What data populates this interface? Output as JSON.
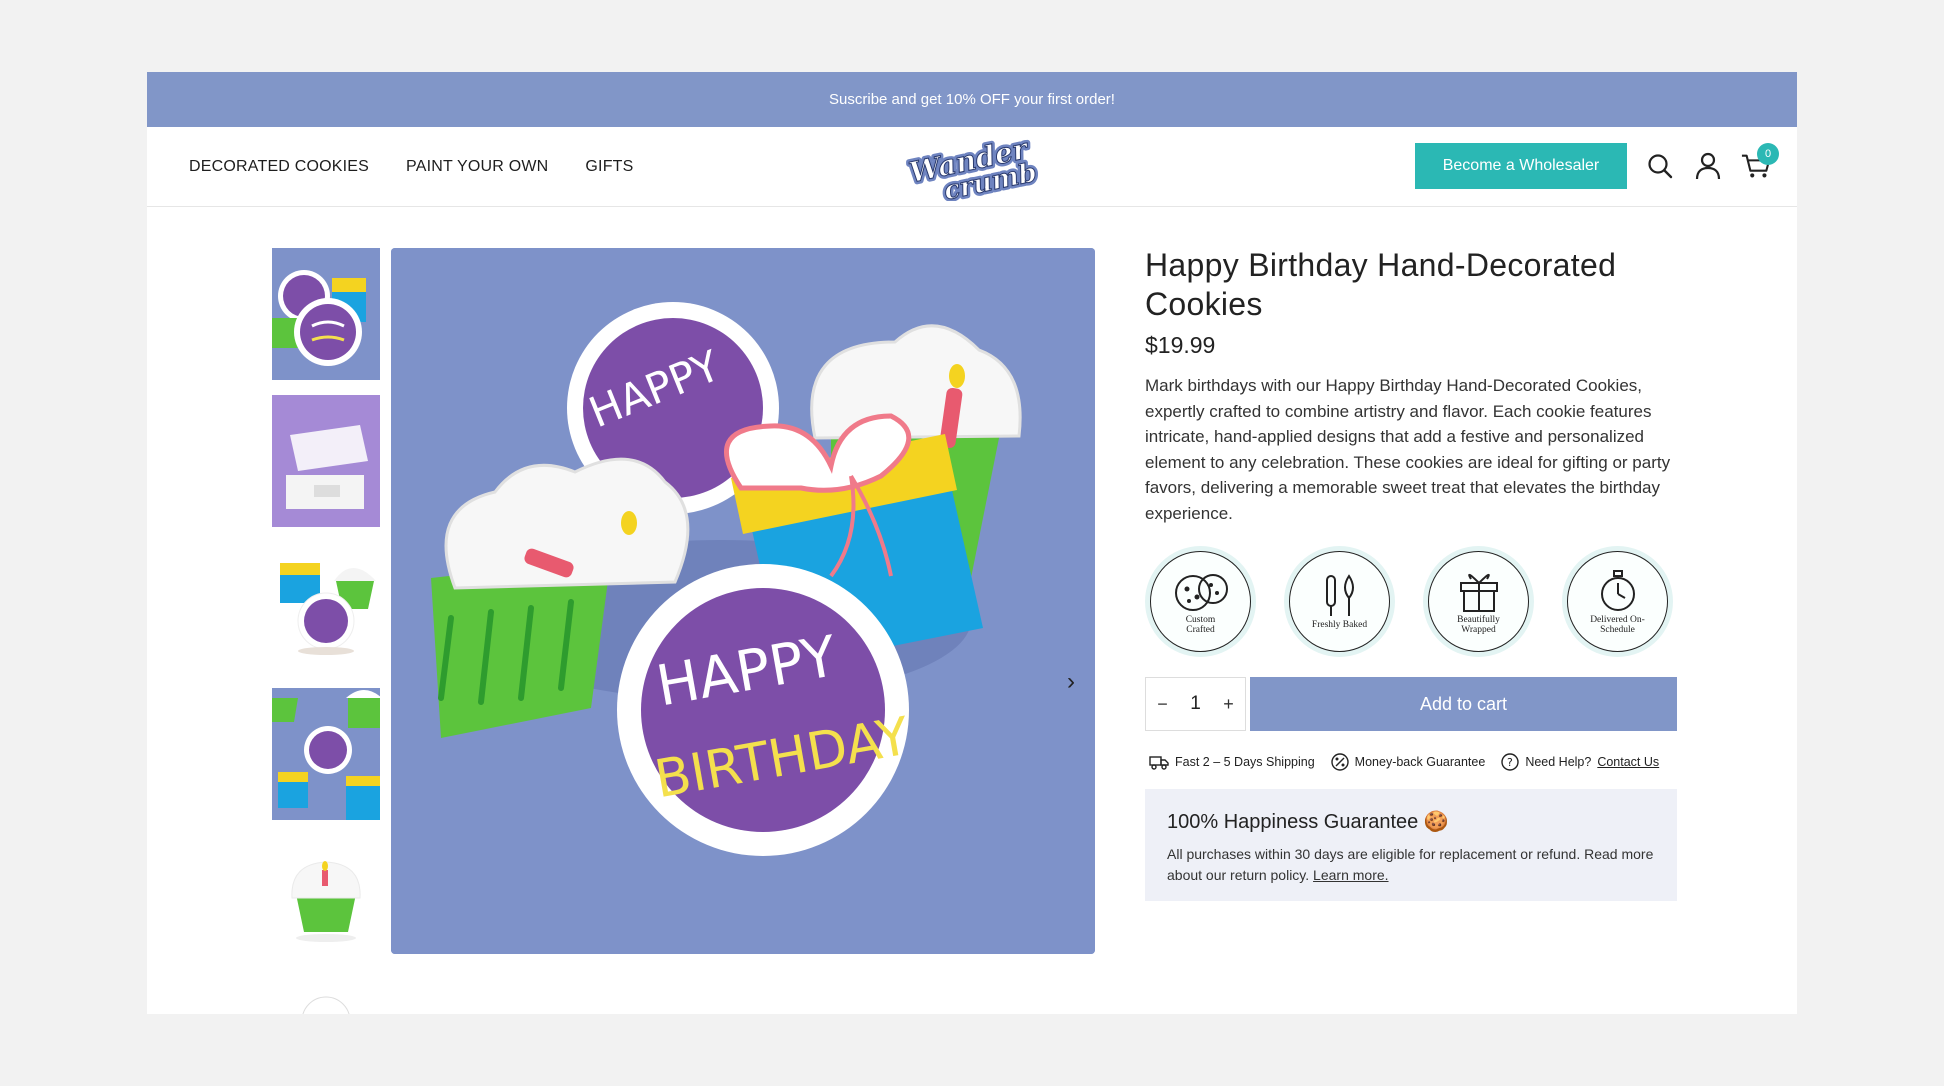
{
  "announcement": "Suscribe and get 10% OFF your first order!",
  "nav": [
    {
      "label": "DECORATED COOKIES"
    },
    {
      "label": "PAINT YOUR OWN"
    },
    {
      "label": "GIFTS"
    }
  ],
  "logo": {
    "line1": "Wander",
    "line2": "crumb"
  },
  "header": {
    "wholesale_label": "Become a Wholesaler",
    "cart_count": "0",
    "icons": [
      "search-icon",
      "account-icon",
      "cart-icon"
    ]
  },
  "product": {
    "title": "Happy Birthday Hand-Decorated Cookies",
    "price": "$19.99",
    "description": "Mark birthdays with our Happy Birthday Hand-Decorated Cookies, expertly crafted to combine artistry and flavor. Each cookie features intricate, hand-applied designs that add a festive and personalized element to any celebration. These cookies are ideal for gifting or party favors, delivering a memorable sweet treat that elevates the birthday experience.",
    "quantity": "1",
    "add_to_cart": "Add to cart",
    "cookie_text_1": "HAPPY",
    "cookie_text_2": "BIRTHDAY"
  },
  "features": [
    {
      "label": "Custom Crafted",
      "icon": "cookie-icon"
    },
    {
      "label": "Freshly Baked",
      "icon": "baking-tools-icon"
    },
    {
      "label": "Beautifully Wrapped",
      "icon": "gift-icon"
    },
    {
      "label": "Delivered On-Schedule",
      "icon": "stopwatch-icon"
    }
  ],
  "perks": {
    "shipping": "Fast 2 – 5 Days Shipping",
    "guarantee": "Money-back Guarantee",
    "help": "Need Help?",
    "contact": "Contact Us"
  },
  "guarantee": {
    "title": "100% Happiness Guarantee 🍪",
    "text": "All purchases within 30 days are eligible for replacement or refund. Read more about our return policy.",
    "link": "Learn more."
  },
  "colors": {
    "accent": "#8196c8",
    "teal": "#2bb8b4"
  }
}
